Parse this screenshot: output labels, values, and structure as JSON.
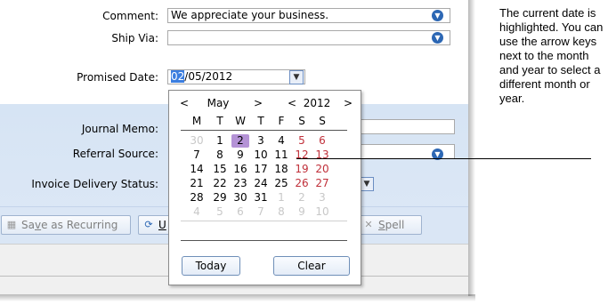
{
  "form": {
    "comment_label": "Comment:",
    "comment_value": "We appreciate your business.",
    "ship_via_label": "Ship Via:",
    "ship_via_value": "",
    "promised_date_label": "Promised Date:",
    "promised_date_month": "02",
    "promised_date_rest": "/05/2012",
    "journal_memo_label": "Journal Memo:",
    "referral_source_label": "Referral Source:",
    "invoice_delivery_label": "Invoice Delivery Status:"
  },
  "buttons": {
    "save_recurring_prefix": "Sa",
    "save_recurring_underlined": "v",
    "save_recurring_suffix": "e as Recurring",
    "use_recurring_underlined": "U",
    "spell_prefix": "",
    "spell_underlined": "S",
    "spell_suffix": "pell"
  },
  "calendar": {
    "month": "May",
    "year": "2012",
    "prev_arrow": "<",
    "next_arrow": ">",
    "weekdays": [
      "M",
      "T",
      "W",
      "T",
      "F",
      "S",
      "S"
    ],
    "weeks": [
      [
        {
          "d": "30",
          "t": "oth"
        },
        {
          "d": "1",
          "t": "cur"
        },
        {
          "d": "2",
          "t": "today"
        },
        {
          "d": "3",
          "t": "cur"
        },
        {
          "d": "4",
          "t": "cur"
        },
        {
          "d": "5",
          "t": "we"
        },
        {
          "d": "6",
          "t": "we"
        }
      ],
      [
        {
          "d": "7",
          "t": "cur"
        },
        {
          "d": "8",
          "t": "cur"
        },
        {
          "d": "9",
          "t": "cur"
        },
        {
          "d": "10",
          "t": "cur"
        },
        {
          "d": "11",
          "t": "cur"
        },
        {
          "d": "12",
          "t": "we"
        },
        {
          "d": "13",
          "t": "we"
        }
      ],
      [
        {
          "d": "14",
          "t": "cur"
        },
        {
          "d": "15",
          "t": "cur"
        },
        {
          "d": "16",
          "t": "cur"
        },
        {
          "d": "17",
          "t": "cur"
        },
        {
          "d": "18",
          "t": "cur"
        },
        {
          "d": "19",
          "t": "we"
        },
        {
          "d": "20",
          "t": "we"
        }
      ],
      [
        {
          "d": "21",
          "t": "cur"
        },
        {
          "d": "22",
          "t": "cur"
        },
        {
          "d": "23",
          "t": "cur"
        },
        {
          "d": "24",
          "t": "cur"
        },
        {
          "d": "25",
          "t": "cur"
        },
        {
          "d": "26",
          "t": "we"
        },
        {
          "d": "27",
          "t": "we"
        }
      ],
      [
        {
          "d": "28",
          "t": "cur"
        },
        {
          "d": "29",
          "t": "cur"
        },
        {
          "d": "30",
          "t": "cur"
        },
        {
          "d": "31",
          "t": "cur"
        },
        {
          "d": "1",
          "t": "oth"
        },
        {
          "d": "2",
          "t": "oth"
        },
        {
          "d": "3",
          "t": "oth"
        }
      ],
      [
        {
          "d": "4",
          "t": "oth"
        },
        {
          "d": "5",
          "t": "oth"
        },
        {
          "d": "6",
          "t": "oth"
        },
        {
          "d": "7",
          "t": "oth"
        },
        {
          "d": "8",
          "t": "oth"
        },
        {
          "d": "9",
          "t": "oth"
        },
        {
          "d": "10",
          "t": "oth"
        }
      ]
    ],
    "today_label": "Today",
    "clear_label": "Clear"
  },
  "annotation": {
    "text": "The current date is highlighted. You can use the arrow keys next to the month and year to select a different month or year."
  },
  "icons": {
    "dropdown": "chevron-down-icon",
    "save_recurring": "save-recurring-icon",
    "use_recurring": "use-recurring-icon",
    "spell": "spell-check-icon"
  },
  "colors": {
    "accent_blue": "#2c67b4",
    "selected_day": "#b492d6",
    "weekend_red": "#c0303a",
    "panel_blue": "#d6e4f4"
  }
}
